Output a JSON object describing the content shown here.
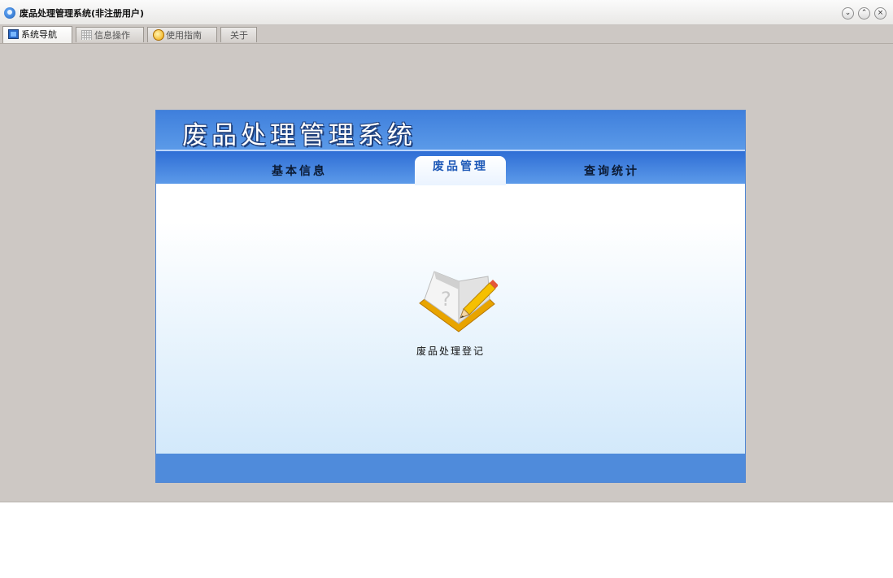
{
  "window": {
    "title": "废品处理管理系统(非注册用户)",
    "controls": {
      "minimize": "⌄",
      "maximize": "⌃",
      "close": "×"
    }
  },
  "tabs": [
    {
      "label": "系统导航",
      "icon": "monitor-icon",
      "active": true
    },
    {
      "label": "信息操作",
      "icon": "grid-icon",
      "active": false
    },
    {
      "label": "使用指南",
      "icon": "guide-icon",
      "active": false
    },
    {
      "label": "关于",
      "icon": "",
      "active": false
    }
  ],
  "panel": {
    "banner_title": "废品处理管理系统",
    "nav": [
      {
        "label": "基本信息",
        "active": false
      },
      {
        "label": "废品管理",
        "active": true
      },
      {
        "label": "查询统计",
        "active": false
      }
    ],
    "item": {
      "label": "废品处理登记",
      "icon": "book-pencil-icon"
    }
  },
  "colors": {
    "banner": "#3f7fdc",
    "active_nav_text": "#1e59b7",
    "footer": "#4f8bdb",
    "window_bg": "#cdc8c4"
  }
}
